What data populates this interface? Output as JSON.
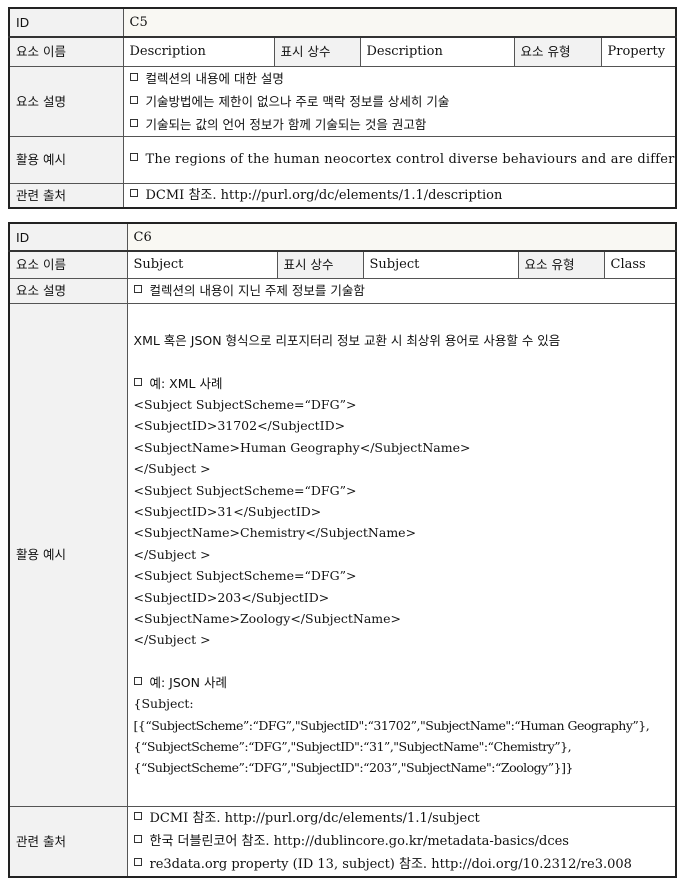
{
  "tables": [
    {
      "id_label": "ID",
      "id_value": "C5",
      "name_label": "요소 이름",
      "name_value": "Description",
      "display_label": "표시 상수",
      "display_value": "Description",
      "type_label": "요소 유형",
      "type_value": "Property",
      "desc_label": "요소 설명",
      "desc_items": [
        "컬렉션의 내용에 대한 설명",
        "기술방법에는 제한이 없으나 주로 맥락 정보를 상세히 기술",
        "기술되는 값의 언어 정보가 함께 기술되는 것을 권고함"
      ],
      "example_label": "활용 예시",
      "example_text": "The regions of the human neocortex control diverse behaviours and are differentially affected by disease...",
      "source_label": "관련 출처",
      "source_items": [
        "DCMI 참조. http://purl.org/dc/elements/1.1/description"
      ]
    },
    {
      "id_label": "ID",
      "id_value": "C6",
      "name_label": "요소 이름",
      "name_value": "Subject",
      "display_label": "표시 상수",
      "display_value": "Subject",
      "type_label": "요소 유형",
      "type_value": "Class",
      "desc_label": "요소 설명",
      "desc_items": [
        "컬렉션의 내용이 지닌 주제 정보를 기술함"
      ],
      "example_label": "활용 예시",
      "example_intro": "XML 혹은 JSON 형식으로 리포지터리 정보 교환 시 최상위 용어로 사용할 수 있음",
      "xml_heading": "예: XML 사례",
      "xml_lines": [
        "<Subject SubjectScheme=“DFG”>",
        "<SubjectID>31702</SubjectID>",
        "<SubjectName>Human Geography</SubjectName>",
        "</Subject >",
        "<Subject SubjectScheme=“DFG”>",
        "<SubjectID>31</SubjectID>",
        "<SubjectName>Chemistry</SubjectName>",
        "</Subject >",
        "<Subject SubjectScheme=“DFG”>",
        "<SubjectID>203</SubjectID>",
        "<SubjectName>Zoology</SubjectName>",
        "</Subject >"
      ],
      "json_heading": "예: JSON 사례",
      "json_lines": [
        "{Subject:",
        "[{“SubjectScheme”:“DFG”,\"SubjectID\":“31702”,\"SubjectName\":“Human Geography”},",
        "{“SubjectScheme”:“DFG”,\"SubjectID\":“31”,\"SubjectName\":“Chemistry”},",
        "{“SubjectScheme”:“DFG”,\"SubjectID\":“203”,\"SubjectName\":“Zoology”}]}"
      ],
      "source_label": "관련 출처",
      "source_items": [
        "DCMI 참조. http://purl.org/dc/elements/1.1/subject",
        "한국 더블린코어 참조. http://dublincore.go.kr/metadata-basics/dces",
        "re3data.org property (ID 13, subject) 참조. http://doi.org/10.2312/re3.008"
      ]
    }
  ]
}
